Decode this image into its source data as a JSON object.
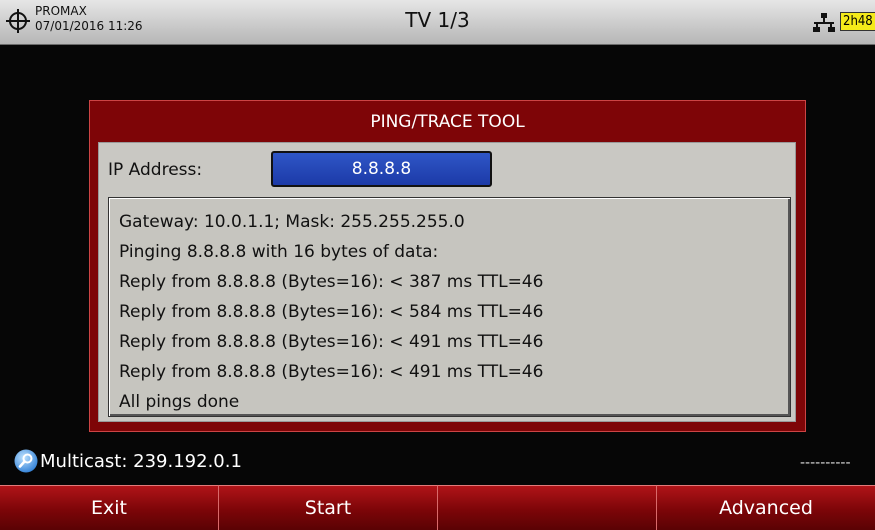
{
  "header": {
    "brand": "PROMAX",
    "datetime": "07/01/2016 11:26",
    "title": "TV 1/3",
    "battery": "2h48",
    "icons": {
      "brand": "crosshair-icon",
      "network": "network-icon"
    },
    "colors": {
      "battery": "#f4ea1a"
    }
  },
  "dialog": {
    "title": "PING/TRACE TOOL",
    "ip_label": "IP Address:",
    "ip_value": "8.8.8.8",
    "log": [
      "Gateway: 10.0.1.1; Mask: 255.255.255.0",
      "Pinging 8.8.8.8 with 16 bytes of data:",
      "Reply from 8.8.8.8 (Bytes=16): < 387 ms TTL=46",
      "Reply from 8.8.8.8 (Bytes=16): < 584 ms TTL=46",
      "Reply from 8.8.8.8 (Bytes=16): < 491 ms TTL=46",
      "Reply from 8.8.8.8 (Bytes=16): < 491 ms TTL=46",
      "All pings done"
    ],
    "colors": {
      "frame": "#7e0507",
      "input": "#2a4fc0"
    }
  },
  "status": {
    "multicast": "Multicast: 239.192.0.1",
    "dashes": "----------",
    "icon": "search-icon"
  },
  "softkeys": {
    "exit": "Exit",
    "start": "Start",
    "empty": "",
    "advanced": "Advanced"
  }
}
